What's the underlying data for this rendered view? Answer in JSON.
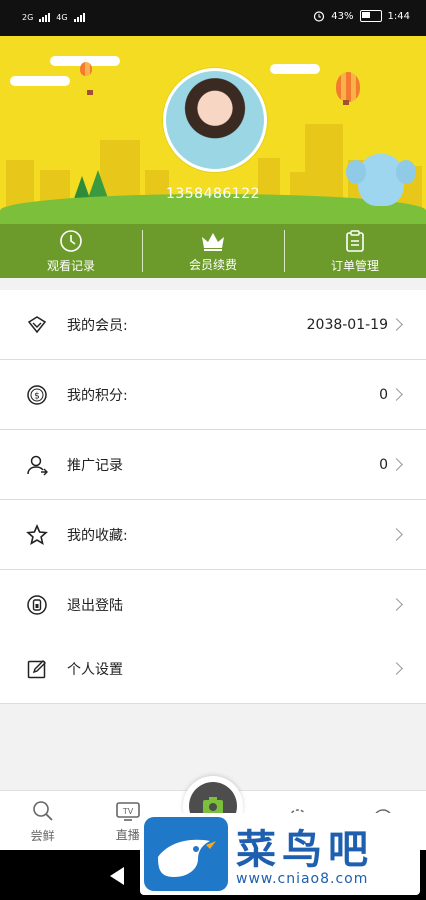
{
  "status_bar": {
    "sim1": "2G",
    "sim2": "4G",
    "battery_percent": "43%",
    "time": "1:44"
  },
  "profile": {
    "phone": "1358486122"
  },
  "quick_actions": [
    {
      "label": "观看记录",
      "icon": "clock-icon"
    },
    {
      "label": "会员续费",
      "icon": "crown-icon"
    },
    {
      "label": "订单管理",
      "icon": "clipboard-icon"
    }
  ],
  "menu": [
    {
      "label": "我的会员:",
      "value": "2038-01-19",
      "icon": "diamond-icon"
    },
    {
      "label": "我的积分:",
      "value": "0",
      "icon": "coin-icon"
    },
    {
      "label": "推广记录",
      "value": "0",
      "icon": "user-share-icon"
    },
    {
      "label": "我的收藏:",
      "value": "",
      "icon": "star-icon"
    },
    {
      "label": "退出登陆",
      "value": "",
      "icon": "logout-icon"
    }
  ],
  "settings": {
    "label": "个人设置",
    "icon": "edit-icon"
  },
  "tabs": [
    {
      "label": "尝鲜",
      "icon": "search-icon"
    },
    {
      "label": "直播",
      "icon": "tv-icon"
    },
    {
      "label": "",
      "icon": "camera-icon"
    },
    {
      "label": "",
      "icon": "target-icon"
    },
    {
      "label": "",
      "icon": "smile-icon"
    }
  ],
  "watermark": {
    "title": "菜鸟吧",
    "url": "www.cniao8.com"
  },
  "colors": {
    "hero_yellow": "#f3dc21",
    "quickbar_green": "#6c9b2c",
    "text": "#222222"
  }
}
